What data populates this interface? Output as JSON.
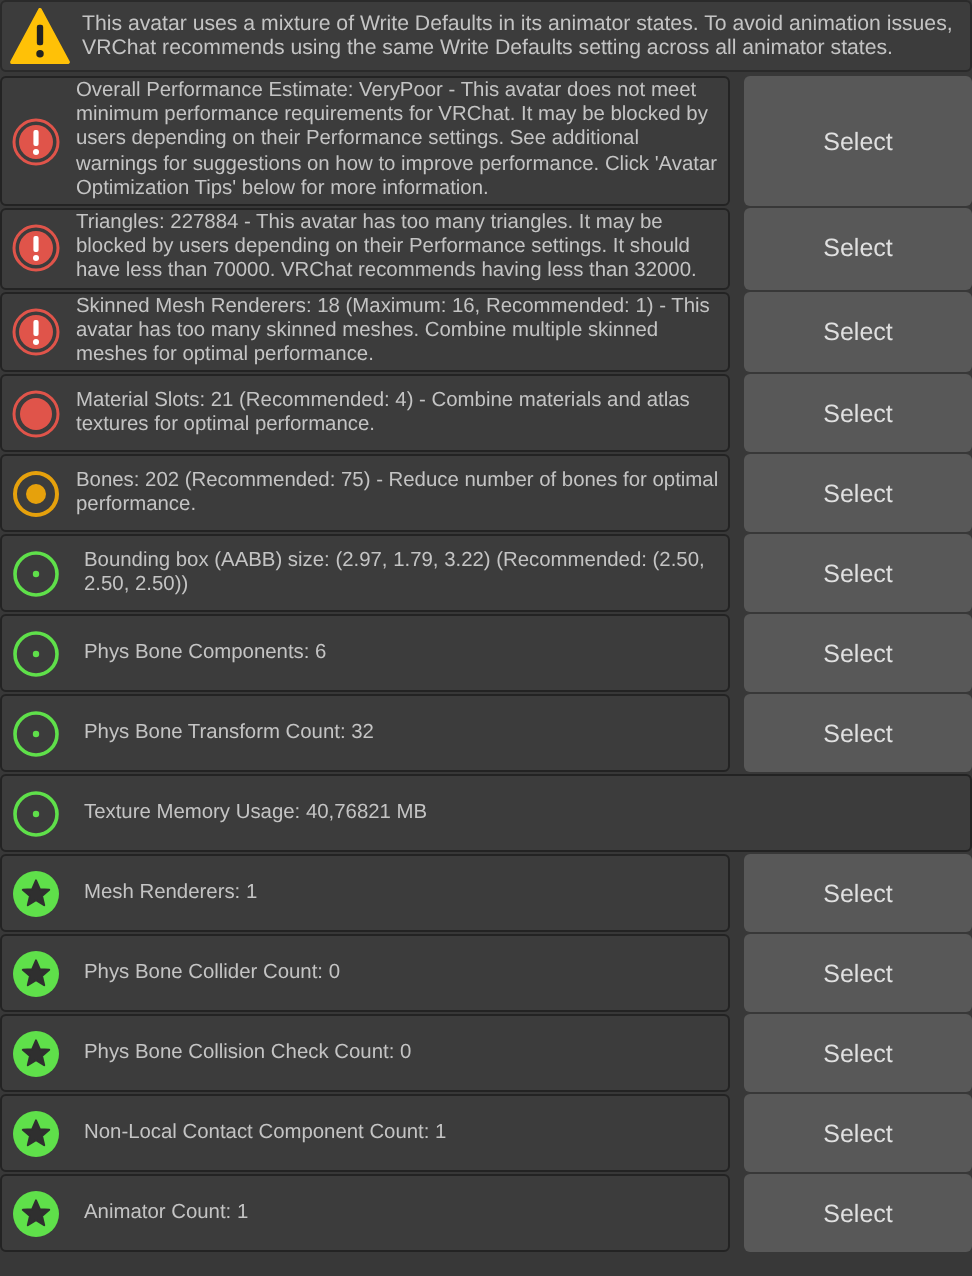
{
  "banner": {
    "kind": "warning",
    "text": "This avatar uses a mixture of Write Defaults in its animator states. To avoid animation issues, VRChat recommends using the same Write Defaults setting across all animator states."
  },
  "messages": [
    {
      "kind": "very-poor",
      "text": "Overall Performance Estimate: VeryPoor - This avatar does not meet minimum performance requirements for VRChat. It may be blocked by users depending on their Performance settings. See additional warnings for suggestions on how to improve performance. Click 'Avatar Optimization Tips' below for more information.",
      "button": "Select"
    },
    {
      "kind": "very-poor",
      "text": "Triangles: 227884 - This avatar has too many triangles. It may be blocked by users depending on their Performance settings. It should have less than 70000. VRChat recommends having less than 32000.",
      "button": "Select"
    },
    {
      "kind": "very-poor",
      "text": "Skinned Mesh Renderers: 18 (Maximum: 16, Recommended: 1) - This avatar has too many skinned meshes. Combine multiple skinned meshes for optimal performance.",
      "button": "Select"
    },
    {
      "kind": "poor",
      "text": "Material Slots: 21 (Recommended: 4) - Combine materials and atlas textures for optimal performance.",
      "button": "Select"
    },
    {
      "kind": "medium",
      "text": "Bones: 202 (Recommended: 75) - Reduce number of bones for optimal performance.",
      "button": "Select"
    },
    {
      "kind": "good",
      "text": "Bounding box (AABB) size: (2.97, 1.79, 3.22) (Recommended: (2.50, 2.50, 2.50))",
      "button": "Select"
    },
    {
      "kind": "good",
      "text": "Phys Bone Components: 6",
      "button": "Select"
    },
    {
      "kind": "good",
      "text": "Phys Bone Transform Count: 32",
      "button": "Select"
    },
    {
      "kind": "good",
      "text": "Texture Memory Usage: 40,76821 MB"
    },
    {
      "kind": "excellent",
      "text": "Mesh Renderers: 1",
      "button": "Select"
    },
    {
      "kind": "excellent",
      "text": "Phys Bone Collider Count: 0",
      "button": "Select"
    },
    {
      "kind": "excellent",
      "text": "Phys Bone Collision Check Count: 0",
      "button": "Select"
    },
    {
      "kind": "excellent",
      "text": "Non-Local Contact Component Count: 1",
      "button": "Select"
    },
    {
      "kind": "excellent",
      "text": "Animator Count: 1",
      "button": "Select"
    }
  ]
}
